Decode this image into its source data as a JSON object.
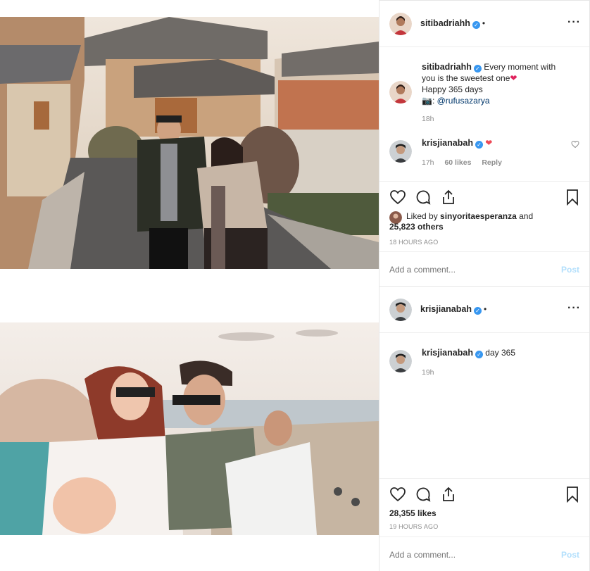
{
  "post1": {
    "author": {
      "username": "sitibadriahh",
      "dot": "•"
    },
    "caption": {
      "username": "sitibadriahh",
      "line1": "Every moment with",
      "line2": "you is the sweetest one",
      "line3": "Happy 365 days",
      "line4_prefix": "📷: ",
      "mention": "@rufusazarya",
      "time": "18h"
    },
    "reply": {
      "username": "krisjianabah",
      "text": "❤",
      "time": "17h",
      "likes": "60 likes",
      "reply_label": "Reply"
    },
    "liked_by_prefix": "Liked by",
    "liked_by_user": "sinyoritaesperanza",
    "liked_by_and": "and",
    "liked_by_others": "25,823 others",
    "timestamp": "18 HOURS AGO",
    "add_comment_placeholder": "Add a comment...",
    "post_label": "Post"
  },
  "post2": {
    "author": {
      "username": "krisjianabah",
      "dot": "•"
    },
    "caption": {
      "username": "krisjianabah",
      "text": "day 365",
      "time": "19h"
    },
    "likes": "28,355 likes",
    "timestamp": "19 HOURS AGO",
    "add_comment_placeholder": "Add a comment...",
    "post_label": "Post"
  },
  "icons": [
    "heart-icon",
    "comment-icon",
    "share-icon",
    "bookmark-icon",
    "more-options-icon",
    "verified-badge-icon"
  ],
  "colors": {
    "link": "#00376b",
    "verified": "#3897f0",
    "post_button": "#b2dffc",
    "heart_red": "#ed4956"
  }
}
